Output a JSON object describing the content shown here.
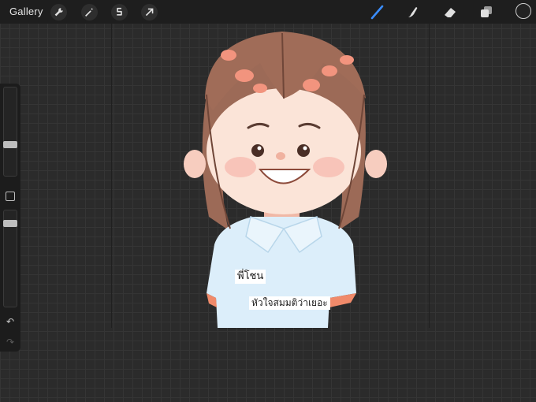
{
  "topbar": {
    "gallery_label": "Gallery",
    "left_tools": [
      {
        "icon": "wrench-icon"
      },
      {
        "icon": "magic-wand-icon"
      },
      {
        "icon": "selection-icon"
      },
      {
        "icon": "transform-arrow-icon"
      }
    ],
    "right_tools": [
      {
        "icon": "brush-icon",
        "active": true,
        "color": "#3a8dff"
      },
      {
        "icon": "smudge-icon"
      },
      {
        "icon": "eraser-icon"
      },
      {
        "icon": "layers-icon"
      }
    ],
    "current_color": "#222222"
  },
  "sidebar": {
    "brush_size": 0.65,
    "opacity": 0.95,
    "icons": [
      "modify-button-icon",
      "undo-icon",
      "redo-icon"
    ]
  },
  "canvas": {
    "name_text": "พี่โชน",
    "message_text": "หัวใจสมมติว่าเยอะ"
  }
}
